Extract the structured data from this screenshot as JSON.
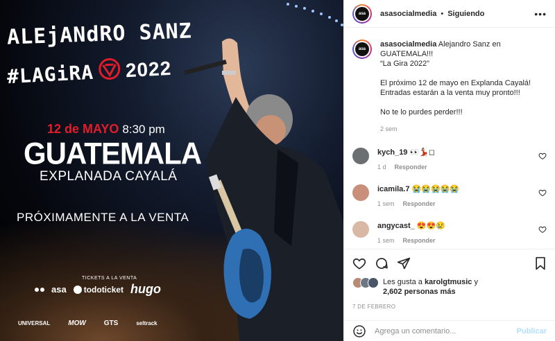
{
  "poster": {
    "title_line1": "ALEjANdRO SANZ",
    "title_line2": "#LAGiRA",
    "title_year": "2022",
    "date_red": "12 de MAYO",
    "time": "8:30 pm",
    "city": "GUATEMALA",
    "venue": "EXPLANADA CAYALÁ",
    "soon": "PRÓXIMAMENTE A LA VENTA",
    "tickets_label": "TICKETS A LA VENTA",
    "sponsor_asa": "asa",
    "sponsor_todoticket": "todoticket",
    "sponsor_hugo": "hugo",
    "footer_universal": "UNIVERSAL",
    "footer_mow": "MOW",
    "footer_gts": "GTS",
    "footer_seltrack": "seltrack",
    "accent_red": "#e21d2b"
  },
  "header": {
    "avatar_text": "asa",
    "username": "asasocialmedia",
    "separator": "•",
    "following": "Siguiendo",
    "more": "•••"
  },
  "caption": {
    "username": "asasocialmedia",
    "line1": " Alejandro Sanz en GUATEMALA!!!",
    "line2": "“La Gira 2022”",
    "line3": "El próximo 12 de mayo en Explanda Cayalá!",
    "line4": "Entradas estarán a la venta muy pronto!!!",
    "line5": "No te lo purdes perder!!!",
    "age": "2 sem"
  },
  "comments": [
    {
      "username": "kych_19",
      "text": "👀💃🏻◻",
      "age": "1 d",
      "reply": "Responder",
      "avatar_color": "#6b6f72"
    },
    {
      "username": "icamila.7",
      "text": "😭😭😭😭😭",
      "age": "1 sem",
      "reply": "Responder",
      "avatar_color": "#c98f7a"
    },
    {
      "username": "angycast_",
      "text": "😍😍😢",
      "age": "1 sem",
      "reply": "Responder",
      "avatar_color": "#d9b9a5"
    }
  ],
  "likes": {
    "prefix": "Les gusta a ",
    "user": "karolgtmusic",
    "suffix": " y",
    "count": "2,602 personas más"
  },
  "post_date": "7 DE FEBRERO",
  "comment_box": {
    "placeholder": "Agrega un comentario...",
    "publish": "Publicar"
  },
  "icons": {
    "like": "heart-icon",
    "comment": "comment-icon",
    "share": "share-icon",
    "save": "bookmark-icon",
    "emoji": "emoji-icon"
  }
}
